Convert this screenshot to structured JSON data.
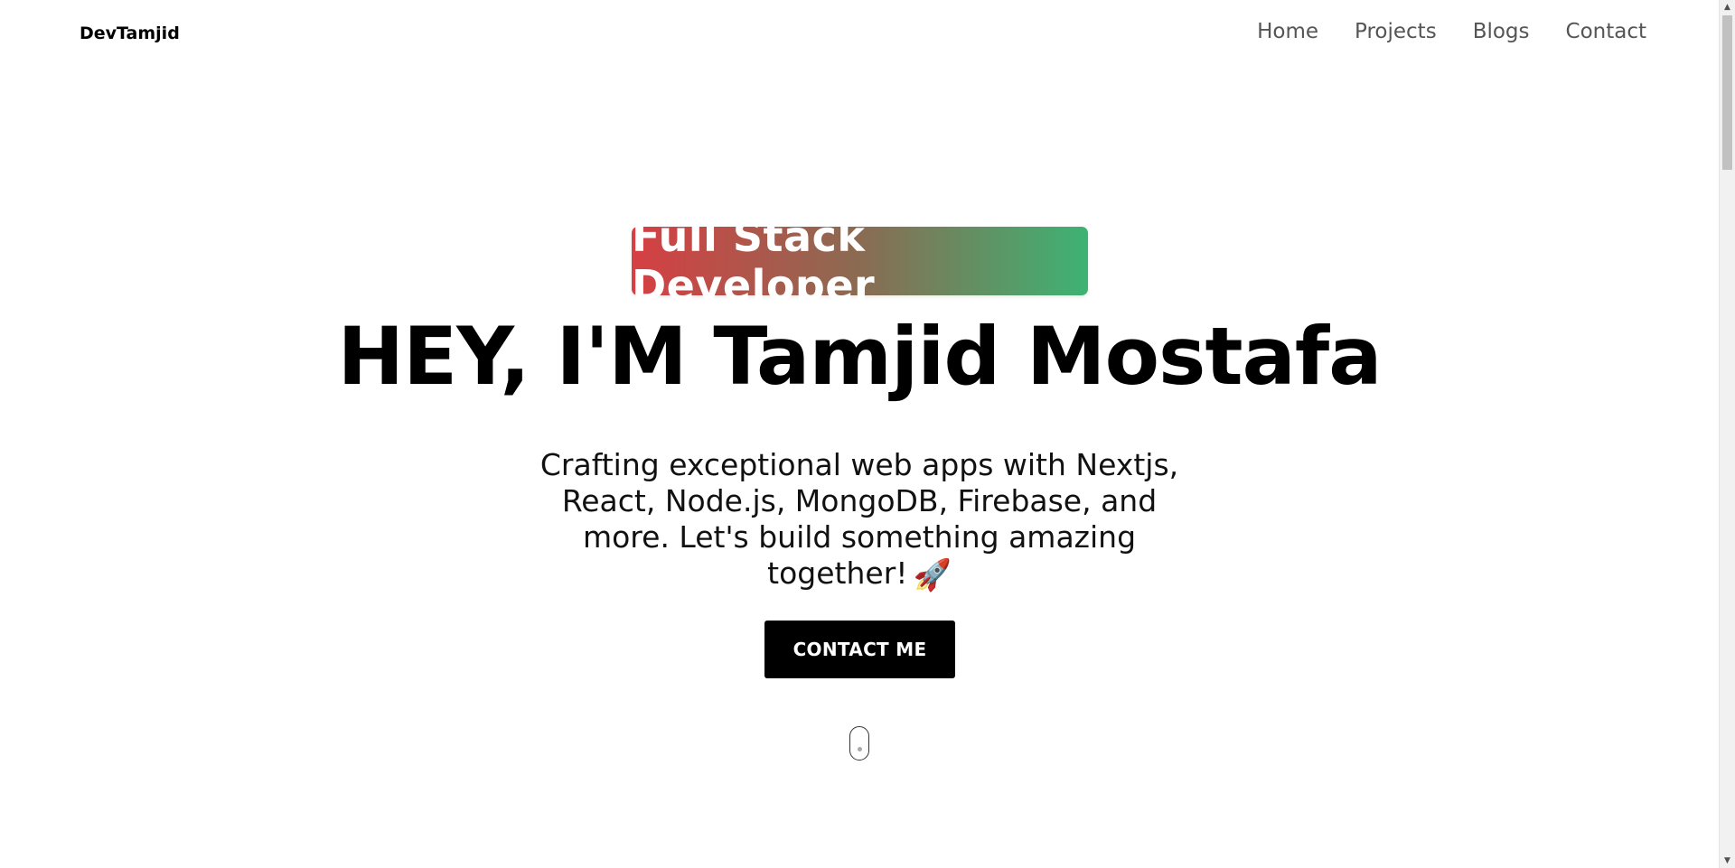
{
  "nav": {
    "brand": "DevTamjid",
    "links": [
      {
        "label": "Home"
      },
      {
        "label": "Projects"
      },
      {
        "label": "Blogs"
      },
      {
        "label": "Contact"
      }
    ]
  },
  "hero": {
    "badge": "Full Stack Developer",
    "headline": "HEY, I'M Tamjid Mostafa",
    "tagline": "Crafting exceptional web apps with Nextjs, React, Node.js, MongoDB, Firebase, and more. Let's build something amazing together!",
    "tagline_emoji": "🚀",
    "cta_label": "CONTACT ME"
  },
  "colors": {
    "badge_gradient_start": "#d63f43",
    "badge_gradient_end": "#3db373",
    "cta_background": "#000000",
    "nav_link": "#555555"
  },
  "icons": {
    "tagline_icon": "rocket-icon",
    "scroll_indicator": "scroll-mouse-icon"
  }
}
